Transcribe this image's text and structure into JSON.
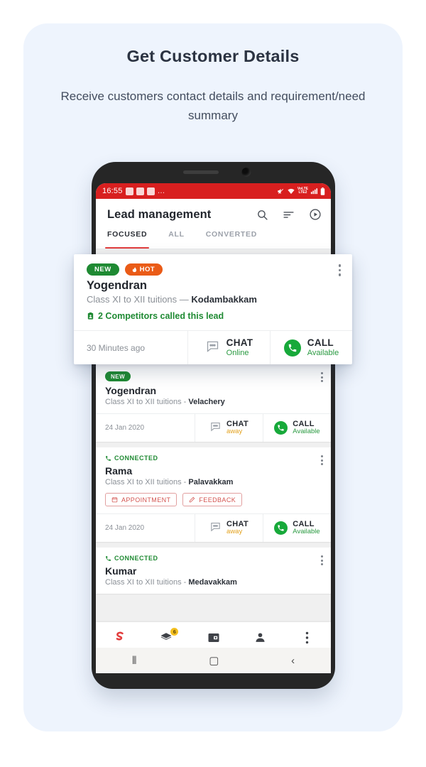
{
  "promo": {
    "title": "Get Customer Details",
    "subtitle": "Receive customers contact details and requirement/need summary"
  },
  "phone": {
    "statusbar": {
      "time": "16:55",
      "overflow": "…",
      "network_label": "VoLTE2",
      "icons": [
        "photo-icon",
        "app-icon",
        "message-icon",
        "mute-icon",
        "wifi-icon",
        "volte-icon",
        "signal-icon",
        "battery-icon"
      ]
    },
    "header": {
      "title": "Lead management",
      "actions": [
        "search-icon",
        "filter-icon",
        "play-icon"
      ]
    },
    "tabs": [
      {
        "label": "FOCUSED",
        "active": true
      },
      {
        "label": "ALL",
        "active": false
      },
      {
        "label": "CONVERTED",
        "active": false
      }
    ],
    "floating_card": {
      "badges": {
        "new": "NEW",
        "hot": "HOT"
      },
      "name": "Yogendran",
      "requirement": "Class XI to XII tuitions",
      "separator": "—",
      "location": "Kodambakkam",
      "competitors": "2 Competitors called this lead",
      "time": "30 Minutes ago",
      "chat": {
        "label": "CHAT",
        "status": "Online"
      },
      "call": {
        "label": "CALL",
        "status": "Available"
      }
    },
    "cards": [
      {
        "status_badge": "NEW",
        "status_type": "new",
        "name": "Yogendran",
        "requirement": "Class XI to XII tuitions -",
        "location": "Velachery",
        "time": "24 Jan 2020",
        "chat": {
          "label": "CHAT",
          "status": "away"
        },
        "call": {
          "label": "CALL",
          "status": "Available"
        },
        "chips": []
      },
      {
        "status_badge": "CONNECTED",
        "status_type": "connected",
        "name": "Rama",
        "requirement": "Class XI to XII tuitions -",
        "location": "Palavakkam",
        "time": "24 Jan 2020",
        "chat": {
          "label": "CHAT",
          "status": "away"
        },
        "call": {
          "label": "CALL",
          "status": "Available"
        },
        "chips": [
          "APPOINTMENT",
          "FEEDBACK"
        ]
      },
      {
        "status_badge": "CONNECTED",
        "status_type": "connected",
        "name": "Kumar",
        "requirement": "Class XI to XII tuitions -",
        "location": "Medavakkam",
        "time": "",
        "chat": {
          "label": "",
          "status": ""
        },
        "call": {
          "label": "",
          "status": ""
        },
        "chips": []
      }
    ],
    "bottom_nav": [
      {
        "label": "Home",
        "icon": "home-logo-icon",
        "active": true,
        "badge": ""
      },
      {
        "label": "Leads",
        "icon": "leads-icon",
        "active": false,
        "badge": "6"
      },
      {
        "label": "Campaign",
        "icon": "campaign-icon",
        "active": false,
        "badge": ""
      },
      {
        "label": "Profile",
        "icon": "profile-icon",
        "active": false,
        "badge": ""
      },
      {
        "label": "More",
        "icon": "more-icon",
        "active": false,
        "badge": ""
      }
    ],
    "android_nav": [
      {
        "name": "recents-button",
        "glyph": "⦀"
      },
      {
        "name": "home-button",
        "glyph": "▢"
      },
      {
        "name": "back-button",
        "glyph": "‹"
      }
    ]
  },
  "colors": {
    "panel_bg": "#eef4fd",
    "status_red": "#d81f1f",
    "accent_red": "#e23d3d",
    "green": "#1f8a33",
    "orange": "#ea5b17",
    "away_amber": "#e3a11c",
    "badge_yellow": "#f4c020"
  }
}
